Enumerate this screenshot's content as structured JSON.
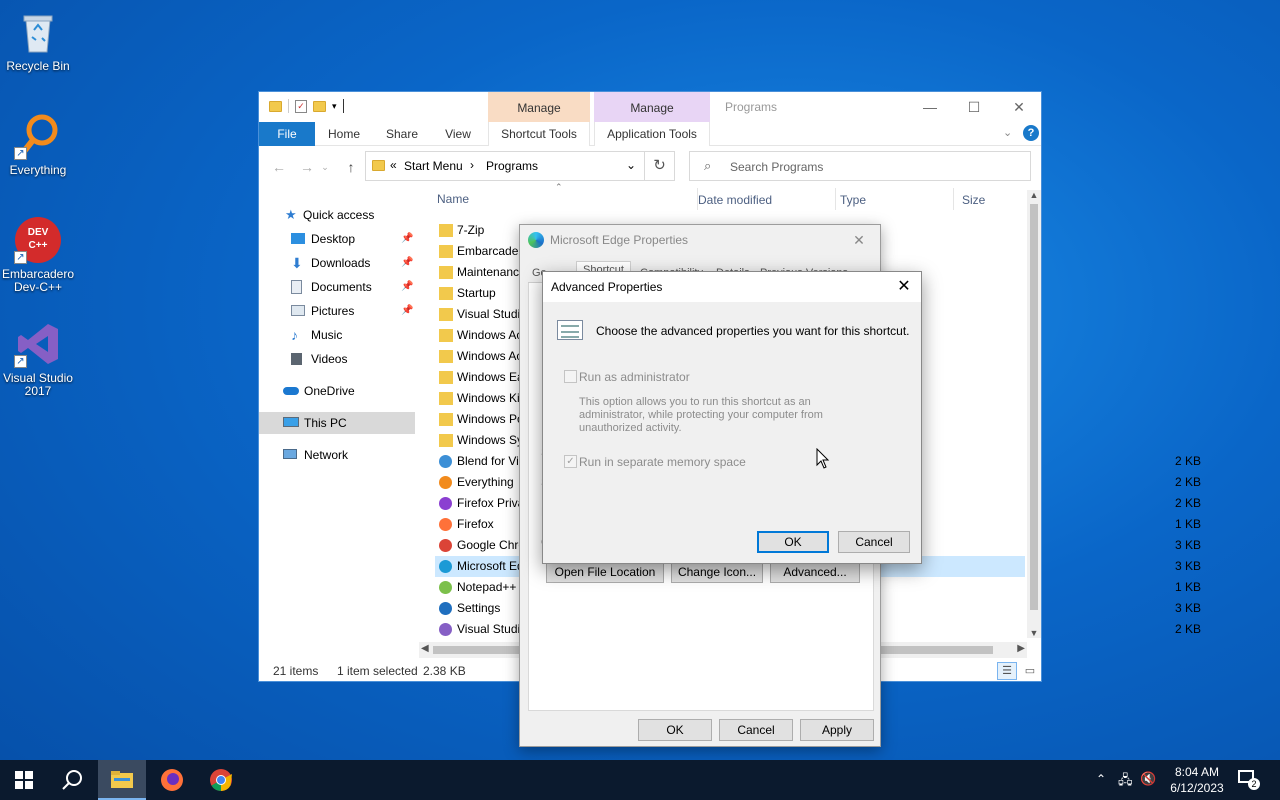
{
  "desktop": {
    "icons": [
      {
        "label": "Recycle Bin"
      },
      {
        "label": "Everything"
      },
      {
        "label": "Embarcadero Dev-C++",
        "badge": "DEV C++"
      },
      {
        "label": "Visual Studio 2017"
      }
    ]
  },
  "explorer": {
    "title": "Programs",
    "context_tabs": [
      {
        "label": "Manage",
        "color": "#f9dcc4"
      },
      {
        "label": "Manage",
        "color": "#e8d5f5"
      }
    ],
    "ribbon_tabs": [
      "File",
      "Home",
      "Share",
      "View",
      "Shortcut Tools",
      "Application Tools"
    ],
    "address": {
      "prefix": "«",
      "parts": [
        "Start Menu",
        "Programs"
      ],
      "sep": "›"
    },
    "search_placeholder": "Search Programs",
    "nav": {
      "quick_access": "Quick access",
      "items": [
        "Desktop",
        "Downloads",
        "Documents",
        "Pictures",
        "Music",
        "Videos"
      ],
      "onedrive": "OneDrive",
      "this_pc": "This PC",
      "network": "Network"
    },
    "columns": [
      "Name",
      "Date modified",
      "Type",
      "Size"
    ],
    "rows": [
      {
        "name": "7-Zip",
        "size": "",
        "kind": "folder"
      },
      {
        "name": "Embarcader",
        "size": "",
        "kind": "folder"
      },
      {
        "name": "Maintenanc",
        "size": "",
        "kind": "folder"
      },
      {
        "name": "Startup",
        "size": "",
        "kind": "folder"
      },
      {
        "name": "Visual Studi",
        "size": "",
        "kind": "folder"
      },
      {
        "name": "Windows Ac",
        "size": "",
        "kind": "folder"
      },
      {
        "name": "Windows Ac",
        "size": "",
        "kind": "folder"
      },
      {
        "name": "Windows Ea",
        "size": "",
        "kind": "folder"
      },
      {
        "name": "Windows Kit",
        "size": "",
        "kind": "folder"
      },
      {
        "name": "Windows Po",
        "size": "",
        "kind": "folder"
      },
      {
        "name": "Windows Sy",
        "size": "",
        "kind": "folder"
      },
      {
        "name": "Blend for Vis",
        "size": "2 KB",
        "kind": "blend"
      },
      {
        "name": "Everything",
        "size": "2 KB",
        "kind": "everything"
      },
      {
        "name": "Firefox Priva",
        "size": "2 KB",
        "kind": "firefox-private"
      },
      {
        "name": "Firefox",
        "size": "1 KB",
        "kind": "firefox"
      },
      {
        "name": "Google Chro",
        "size": "3 KB",
        "kind": "chrome"
      },
      {
        "name": "Microsoft Ed",
        "size": "3 KB",
        "kind": "edge"
      },
      {
        "name": "Notepad++",
        "size": "1 KB",
        "kind": "notepad"
      },
      {
        "name": "Settings",
        "size": "3 KB",
        "kind": "settings"
      },
      {
        "name": "Visual Studio",
        "size": "2 KB",
        "kind": "vs"
      }
    ],
    "status": {
      "count": "21 items",
      "selected": "1 item selected",
      "size": "2.38 KB"
    }
  },
  "properties_dialog": {
    "title": "Microsoft Edge Properties",
    "tabs_visible": [
      "Ge",
      "Shortcut",
      "Compatibility",
      "Details",
      "Previous Versions"
    ],
    "buttons": {
      "open_file_location": "Open File Location",
      "change_icon": "Change Icon...",
      "advanced": "Advanced...",
      "ok": "OK",
      "cancel": "Cancel",
      "apply": "Apply"
    }
  },
  "advanced_dialog": {
    "title": "Advanced Properties",
    "prompt": "Choose the advanced properties you want for this shortcut.",
    "run_as_admin": {
      "label": "Run as administrator",
      "checked": false
    },
    "description_lines": [
      "This option allows you to run this shortcut as an",
      "administrator, while protecting your computer from",
      "unauthorized activity."
    ],
    "separate_memory": {
      "label": "Run in separate memory space",
      "checked": true
    },
    "ok": "OK",
    "cancel": "Cancel"
  },
  "taskbar": {
    "time": "8:04 AM",
    "date": "6/12/2023",
    "notifications": "2"
  }
}
